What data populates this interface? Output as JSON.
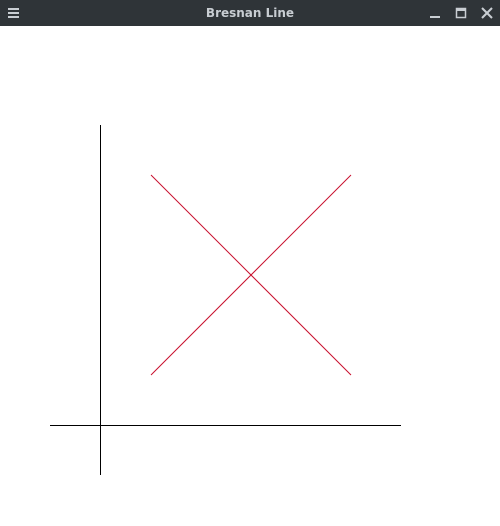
{
  "window": {
    "title": "Bresnan Line",
    "title_color": "#c8cdd2",
    "titlebar_color": "#2f3438"
  },
  "titlebar_buttons": [
    {
      "name": "menu",
      "icon": "hamburger-menu-icon"
    },
    {
      "name": "minimize",
      "icon": "minimize-icon"
    },
    {
      "name": "maximize",
      "icon": "maximize-icon"
    },
    {
      "name": "close",
      "icon": "close-icon"
    }
  ],
  "drawing": {
    "axis_color": "#000000",
    "line_color": "#c8102e",
    "background": "#ffffff"
  }
}
